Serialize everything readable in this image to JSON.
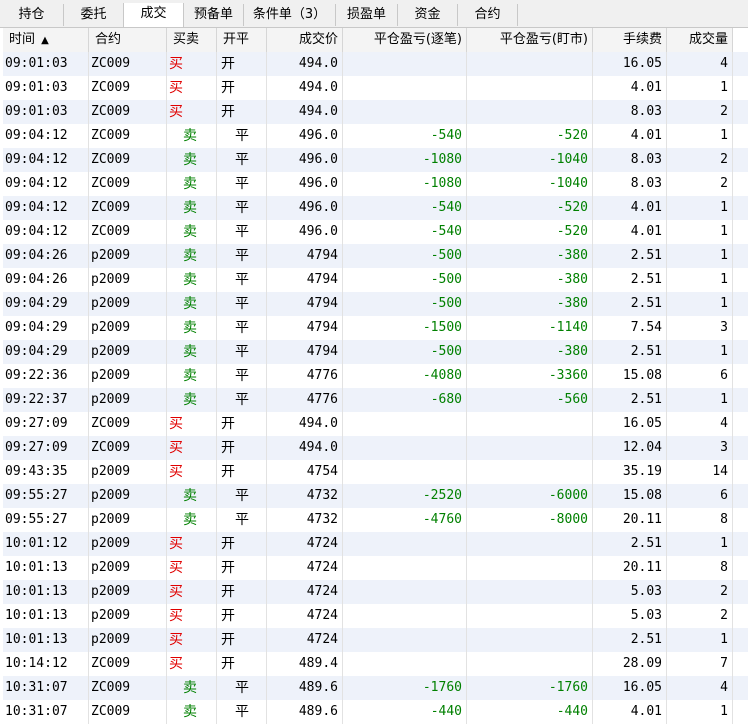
{
  "tabs": [
    {
      "label": "持仓",
      "active": false
    },
    {
      "label": "委托",
      "active": false
    },
    {
      "label": "成交",
      "active": true
    },
    {
      "label": "预备单",
      "active": false
    },
    {
      "label": "条件单（3）",
      "active": false
    },
    {
      "label": "损盈单",
      "active": false
    },
    {
      "label": "资金",
      "active": false
    },
    {
      "label": "合约",
      "active": false
    }
  ],
  "columns": {
    "time": "时间",
    "sort_indicator": "▲",
    "symbol": "合约",
    "side": "买卖",
    "open_close": "开平",
    "price": "成交价",
    "pl_trade": "平仓盈亏(逐笔)",
    "pl_mark": "平仓盈亏(盯市)",
    "fee": "手续费",
    "qty": "成交量"
  },
  "colors": {
    "buy": "#e00000",
    "sell": "#008000"
  },
  "trades": [
    {
      "time": "09:01:03",
      "symbol": "ZC009",
      "side": "买",
      "open_close": "开",
      "price": "494.0",
      "pl_trade": "",
      "pl_mark": "",
      "fee": "16.05",
      "qty": "4"
    },
    {
      "time": "09:01:03",
      "symbol": "ZC009",
      "side": "买",
      "open_close": "开",
      "price": "494.0",
      "pl_trade": "",
      "pl_mark": "",
      "fee": "4.01",
      "qty": "1"
    },
    {
      "time": "09:01:03",
      "symbol": "ZC009",
      "side": "买",
      "open_close": "开",
      "price": "494.0",
      "pl_trade": "",
      "pl_mark": "",
      "fee": "8.03",
      "qty": "2"
    },
    {
      "time": "09:04:12",
      "symbol": "ZC009",
      "side": "卖",
      "open_close": "平",
      "price": "496.0",
      "pl_trade": "-540",
      "pl_mark": "-520",
      "fee": "4.01",
      "qty": "1"
    },
    {
      "time": "09:04:12",
      "symbol": "ZC009",
      "side": "卖",
      "open_close": "平",
      "price": "496.0",
      "pl_trade": "-1080",
      "pl_mark": "-1040",
      "fee": "8.03",
      "qty": "2"
    },
    {
      "time": "09:04:12",
      "symbol": "ZC009",
      "side": "卖",
      "open_close": "平",
      "price": "496.0",
      "pl_trade": "-1080",
      "pl_mark": "-1040",
      "fee": "8.03",
      "qty": "2"
    },
    {
      "time": "09:04:12",
      "symbol": "ZC009",
      "side": "卖",
      "open_close": "平",
      "price": "496.0",
      "pl_trade": "-540",
      "pl_mark": "-520",
      "fee": "4.01",
      "qty": "1"
    },
    {
      "time": "09:04:12",
      "symbol": "ZC009",
      "side": "卖",
      "open_close": "平",
      "price": "496.0",
      "pl_trade": "-540",
      "pl_mark": "-520",
      "fee": "4.01",
      "qty": "1"
    },
    {
      "time": "09:04:26",
      "symbol": "p2009",
      "side": "卖",
      "open_close": "平",
      "price": "4794",
      "pl_trade": "-500",
      "pl_mark": "-380",
      "fee": "2.51",
      "qty": "1"
    },
    {
      "time": "09:04:26",
      "symbol": "p2009",
      "side": "卖",
      "open_close": "平",
      "price": "4794",
      "pl_trade": "-500",
      "pl_mark": "-380",
      "fee": "2.51",
      "qty": "1"
    },
    {
      "time": "09:04:29",
      "symbol": "p2009",
      "side": "卖",
      "open_close": "平",
      "price": "4794",
      "pl_trade": "-500",
      "pl_mark": "-380",
      "fee": "2.51",
      "qty": "1"
    },
    {
      "time": "09:04:29",
      "symbol": "p2009",
      "side": "卖",
      "open_close": "平",
      "price": "4794",
      "pl_trade": "-1500",
      "pl_mark": "-1140",
      "fee": "7.54",
      "qty": "3"
    },
    {
      "time": "09:04:29",
      "symbol": "p2009",
      "side": "卖",
      "open_close": "平",
      "price": "4794",
      "pl_trade": "-500",
      "pl_mark": "-380",
      "fee": "2.51",
      "qty": "1"
    },
    {
      "time": "09:22:36",
      "symbol": "p2009",
      "side": "卖",
      "open_close": "平",
      "price": "4776",
      "pl_trade": "-4080",
      "pl_mark": "-3360",
      "fee": "15.08",
      "qty": "6"
    },
    {
      "time": "09:22:37",
      "symbol": "p2009",
      "side": "卖",
      "open_close": "平",
      "price": "4776",
      "pl_trade": "-680",
      "pl_mark": "-560",
      "fee": "2.51",
      "qty": "1"
    },
    {
      "time": "09:27:09",
      "symbol": "ZC009",
      "side": "买",
      "open_close": "开",
      "price": "494.0",
      "pl_trade": "",
      "pl_mark": "",
      "fee": "16.05",
      "qty": "4"
    },
    {
      "time": "09:27:09",
      "symbol": "ZC009",
      "side": "买",
      "open_close": "开",
      "price": "494.0",
      "pl_trade": "",
      "pl_mark": "",
      "fee": "12.04",
      "qty": "3"
    },
    {
      "time": "09:43:35",
      "symbol": "p2009",
      "side": "买",
      "open_close": "开",
      "price": "4754",
      "pl_trade": "",
      "pl_mark": "",
      "fee": "35.19",
      "qty": "14"
    },
    {
      "time": "09:55:27",
      "symbol": "p2009",
      "side": "卖",
      "open_close": "平",
      "price": "4732",
      "pl_trade": "-2520",
      "pl_mark": "-6000",
      "fee": "15.08",
      "qty": "6"
    },
    {
      "time": "09:55:27",
      "symbol": "p2009",
      "side": "卖",
      "open_close": "平",
      "price": "4732",
      "pl_trade": "-4760",
      "pl_mark": "-8000",
      "fee": "20.11",
      "qty": "8"
    },
    {
      "time": "10:01:12",
      "symbol": "p2009",
      "side": "买",
      "open_close": "开",
      "price": "4724",
      "pl_trade": "",
      "pl_mark": "",
      "fee": "2.51",
      "qty": "1"
    },
    {
      "time": "10:01:13",
      "symbol": "p2009",
      "side": "买",
      "open_close": "开",
      "price": "4724",
      "pl_trade": "",
      "pl_mark": "",
      "fee": "20.11",
      "qty": "8"
    },
    {
      "time": "10:01:13",
      "symbol": "p2009",
      "side": "买",
      "open_close": "开",
      "price": "4724",
      "pl_trade": "",
      "pl_mark": "",
      "fee": "5.03",
      "qty": "2"
    },
    {
      "time": "10:01:13",
      "symbol": "p2009",
      "side": "买",
      "open_close": "开",
      "price": "4724",
      "pl_trade": "",
      "pl_mark": "",
      "fee": "5.03",
      "qty": "2"
    },
    {
      "time": "10:01:13",
      "symbol": "p2009",
      "side": "买",
      "open_close": "开",
      "price": "4724",
      "pl_trade": "",
      "pl_mark": "",
      "fee": "2.51",
      "qty": "1"
    },
    {
      "time": "10:14:12",
      "symbol": "ZC009",
      "side": "买",
      "open_close": "开",
      "price": "489.4",
      "pl_trade": "",
      "pl_mark": "",
      "fee": "28.09",
      "qty": "7"
    },
    {
      "time": "10:31:07",
      "symbol": "ZC009",
      "side": "卖",
      "open_close": "平",
      "price": "489.6",
      "pl_trade": "-1760",
      "pl_mark": "-1760",
      "fee": "16.05",
      "qty": "4"
    },
    {
      "time": "10:31:07",
      "symbol": "ZC009",
      "side": "卖",
      "open_close": "平",
      "price": "489.6",
      "pl_trade": "-440",
      "pl_mark": "-440",
      "fee": "4.01",
      "qty": "1"
    }
  ]
}
